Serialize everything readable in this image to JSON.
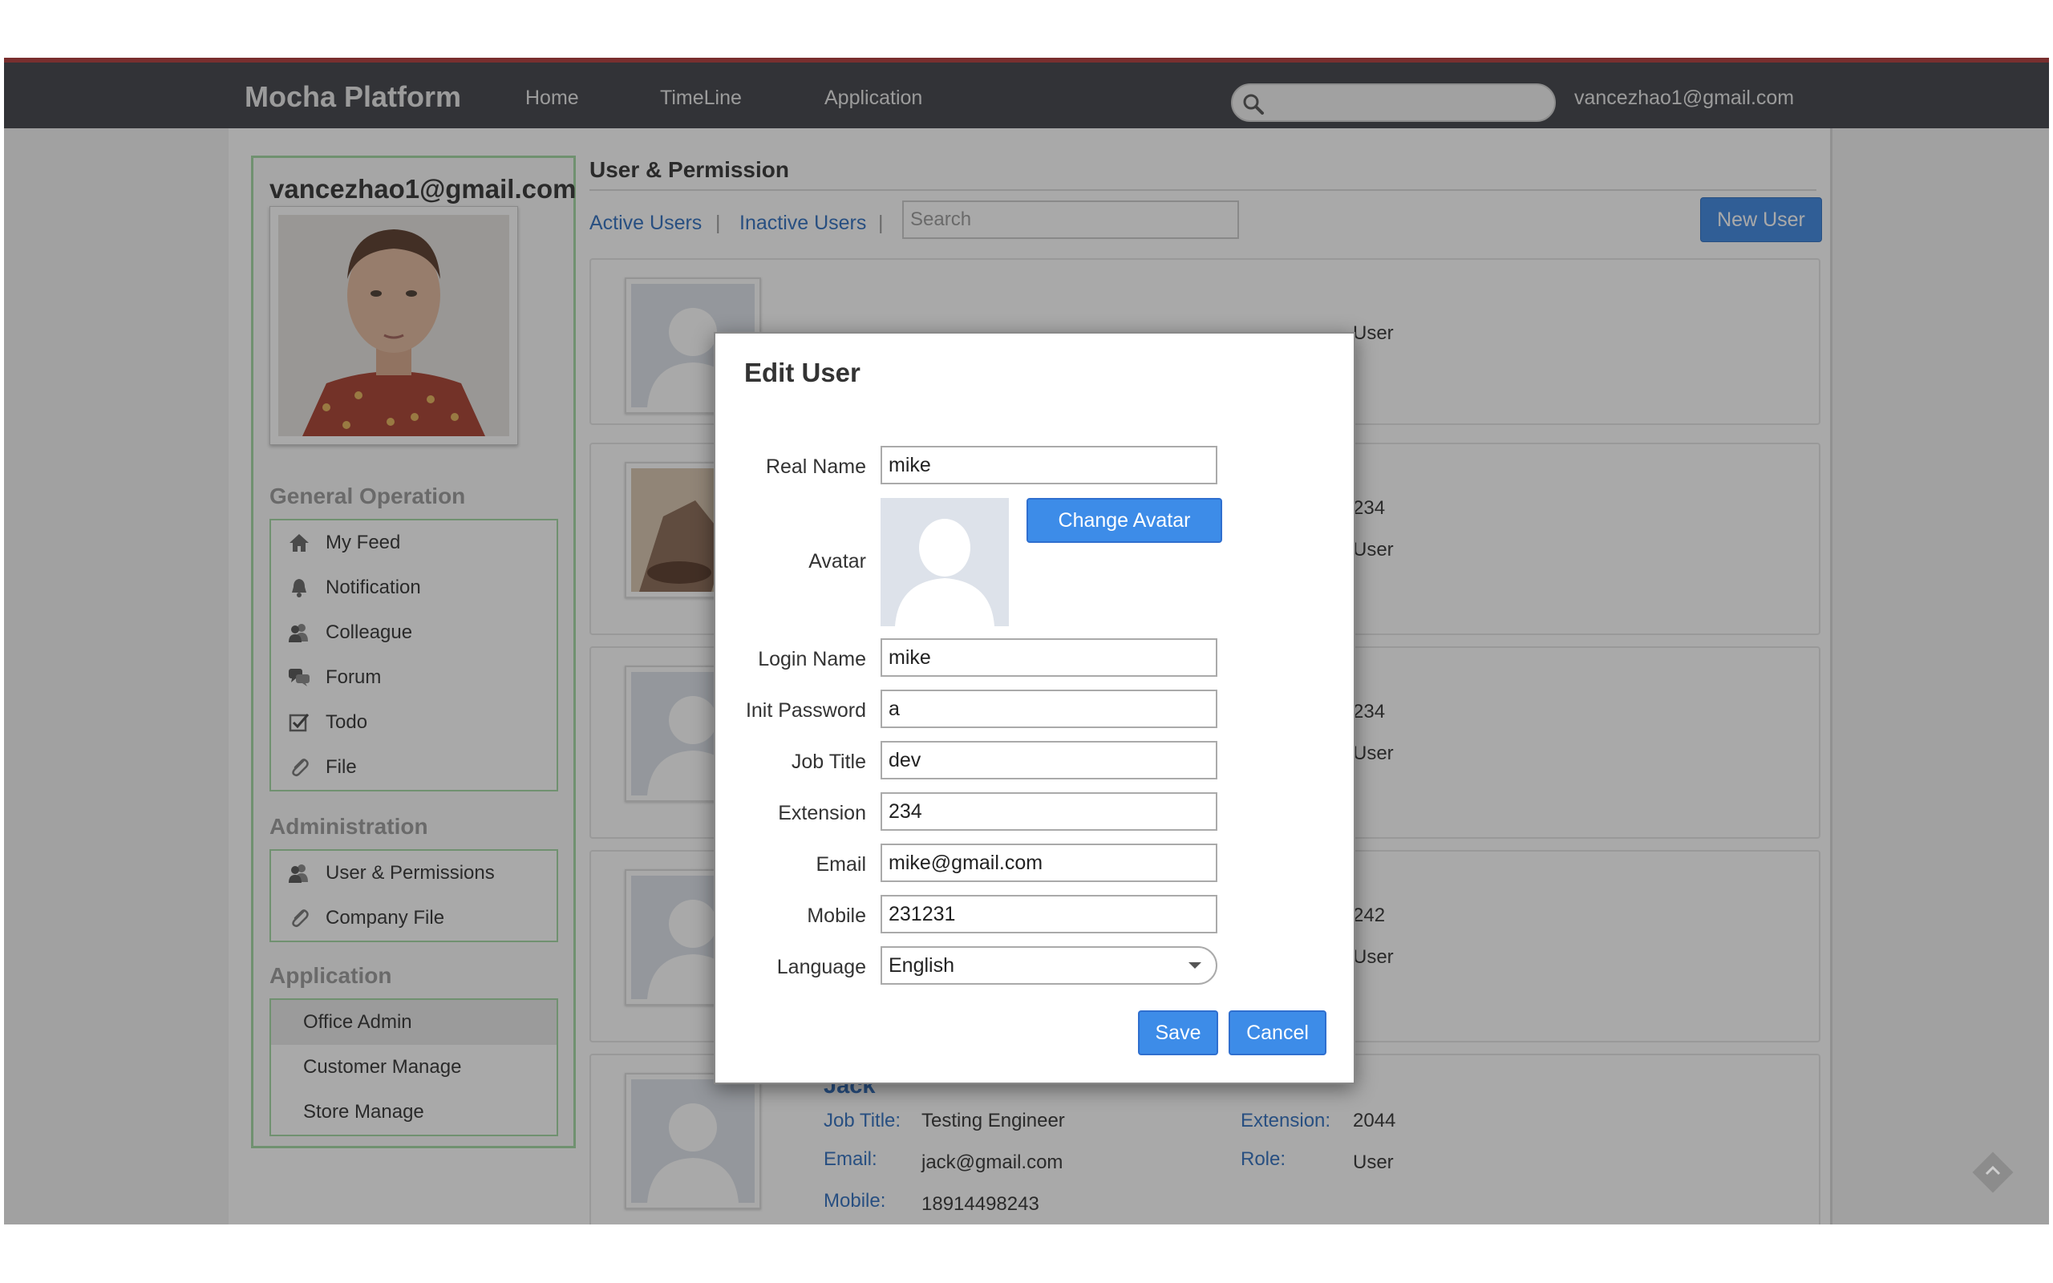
{
  "app": {
    "brand": "Mocha Platform"
  },
  "nav": {
    "home": "Home",
    "timeline": "TimeLine",
    "application": "Application",
    "user_email": "vancezhao1@gmail.com"
  },
  "sidebar": {
    "email": "vancezhao1@gmail.com",
    "general_title": "General Operation",
    "general_items": [
      "My Feed",
      "Notification",
      "Colleague",
      "Forum",
      "Todo",
      "File"
    ],
    "admin_title": "Administration",
    "admin_items": [
      "User & Permissions",
      "Company File"
    ],
    "app_title": "Application",
    "app_items": [
      "Office Admin",
      "Customer Manage",
      "Store Manage"
    ]
  },
  "main": {
    "title": "User & Permission",
    "active_users": "Active Users",
    "inactive_users": "Inactive Users",
    "separator": "|",
    "search_placeholder": "Search",
    "new_user": "New User"
  },
  "cards": {
    "c1": {
      "role": "User"
    },
    "c2": {
      "extension": "234",
      "role": "User"
    },
    "c3": {
      "extension": "234",
      "role": "User"
    },
    "c4": {
      "extension": "242",
      "role": "User"
    },
    "jack": {
      "name": "Jack",
      "job_title_label": "Job Title:",
      "job_title": "Testing Engineer",
      "email_label": "Email:",
      "email": "jack@gmail.com",
      "mobile_label": "Mobile:",
      "mobile": "18914498243",
      "extension_label": "Extension:",
      "extension": "2044",
      "role_label": "Role:",
      "role": "User"
    }
  },
  "modal": {
    "title": "Edit User",
    "real_name_label": "Real Name",
    "real_name": "mike",
    "avatar_label": "Avatar",
    "change_avatar": "Change Avatar",
    "login_name_label": "Login Name",
    "login_name": "mike",
    "init_password_label": "Init Password",
    "init_password": "a",
    "job_title_label": "Job Title",
    "job_title": "dev",
    "extension_label": "Extension",
    "extension": "234",
    "email_label": "Email",
    "email": "mike@gmail.com",
    "mobile_label": "Mobile",
    "mobile": "231231",
    "language_label": "Language",
    "language": "English",
    "save": "Save",
    "cancel": "Cancel"
  },
  "colors": {
    "topbar": "#3f4147",
    "accent": "#3d8ce8",
    "link": "#2f6fbf",
    "panel_border": "#a3d9a3",
    "header_line": "#b23a3a"
  }
}
